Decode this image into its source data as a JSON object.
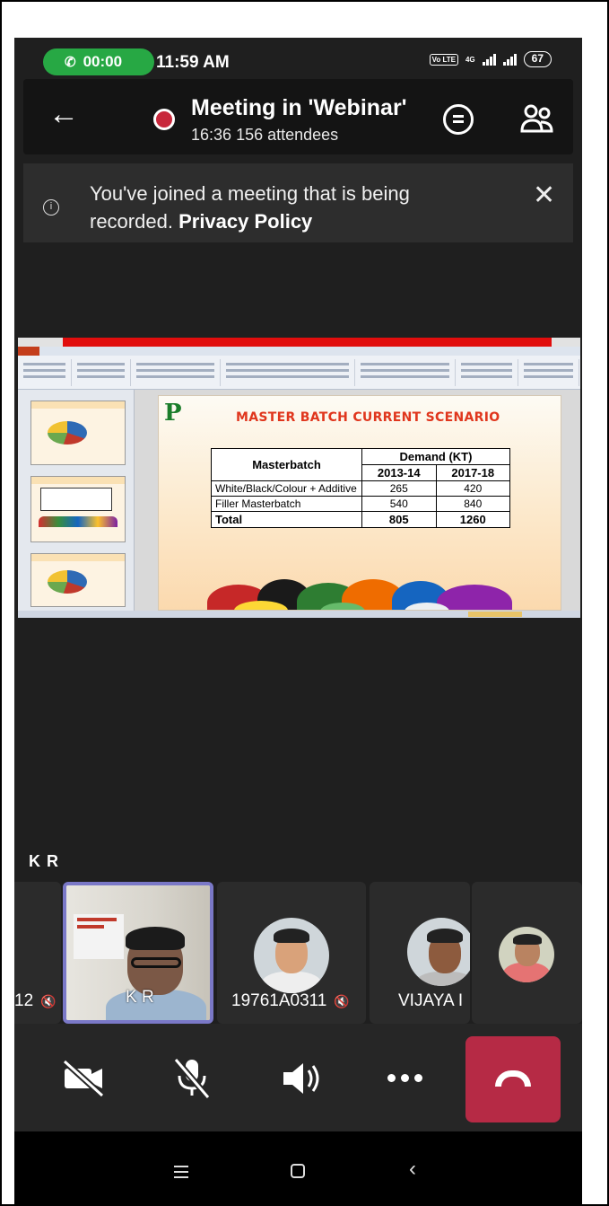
{
  "status_bar": {
    "call_timer": "00:00",
    "time": "11:59 AM",
    "network_type": "4G",
    "volte_label": "Vo LTE",
    "battery": "67",
    "icons": [
      "phone-icon",
      "volte-icon",
      "signal-icon",
      "battery-icon"
    ]
  },
  "meeting": {
    "title": "Meeting in 'Webinar'",
    "elapsed": "16:36",
    "attendees": "156 attendees"
  },
  "banner": {
    "message": "You've joined a meeting that is being recorded.",
    "link": "Privacy Policy"
  },
  "shared_slide": {
    "title": "MASTER BATCH CURRENT SCENARIO",
    "logo_text": "P",
    "table": {
      "header_col": "Masterbatch",
      "header_group": "Demand (KT)",
      "years": [
        "2013-14",
        "2017-18"
      ],
      "rows": [
        {
          "label": "White/Black/Colour + Additive",
          "values": [
            "265",
            "420"
          ]
        },
        {
          "label": "Filler Masterbatch",
          "values": [
            "540",
            "840"
          ]
        }
      ],
      "total": {
        "label": "Total",
        "values": [
          "805",
          "1260"
        ]
      }
    }
  },
  "participants": {
    "speaker_label": "K R",
    "tiles": [
      {
        "name": "12",
        "muted": true
      },
      {
        "name": "K R",
        "muted": false,
        "active": true
      },
      {
        "name": "19761A0311",
        "muted": true
      },
      {
        "name": "VIJAYA I",
        "muted": false
      },
      {
        "name": "",
        "muted": false
      }
    ]
  },
  "colors": {
    "call_pill": "#27a844",
    "end_call": "#b62a45",
    "recording": "#c8283c",
    "active_speaker_border": "#7a78c7"
  }
}
